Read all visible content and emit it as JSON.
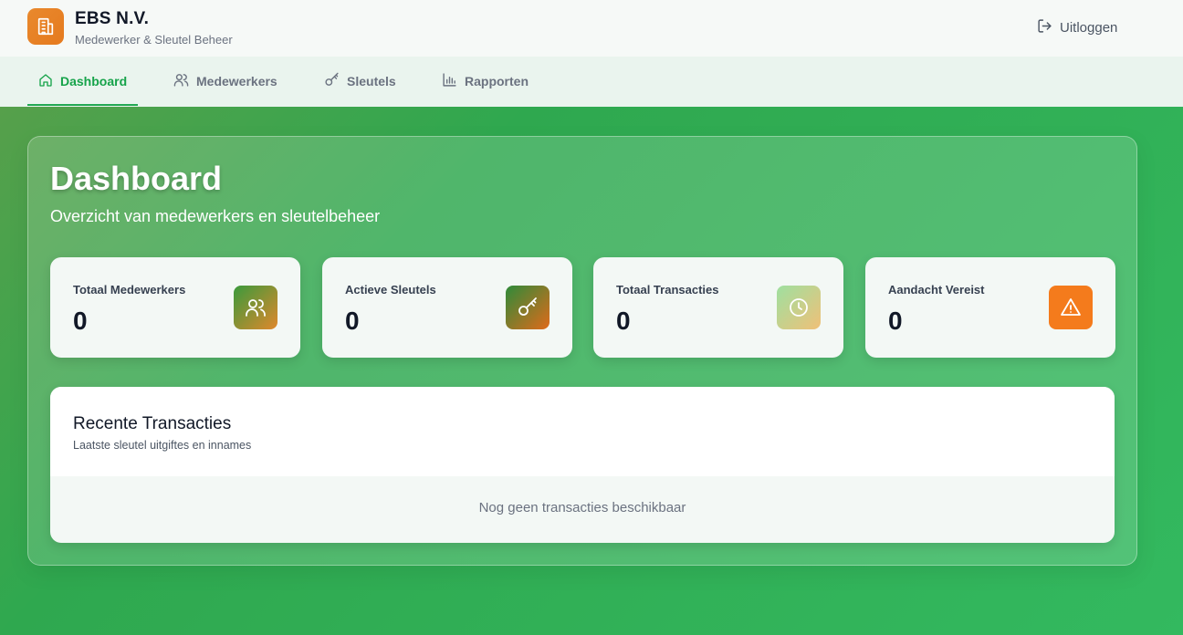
{
  "header": {
    "title": "EBS N.V.",
    "subtitle": "Medewerker & Sleutel Beheer",
    "logo_icon": "building-icon",
    "logout_label": "Uitloggen",
    "logout_icon": "logout-icon"
  },
  "nav": {
    "tabs": [
      {
        "label": "Dashboard",
        "icon": "home-icon",
        "active": true
      },
      {
        "label": "Medewerkers",
        "icon": "users-icon",
        "active": false
      },
      {
        "label": "Sleutels",
        "icon": "key-icon",
        "active": false
      },
      {
        "label": "Rapporten",
        "icon": "bar-chart-icon",
        "active": false
      }
    ]
  },
  "main": {
    "title": "Dashboard",
    "subtitle": "Overzicht van medewerkers en sleutelbeheer",
    "stats": [
      {
        "label": "Totaal Medewerkers",
        "value": "0",
        "icon": "users-icon",
        "color": "#e0882c"
      },
      {
        "label": "Actieve Sleutels",
        "value": "0",
        "icon": "key-icon",
        "color": "#2f8a3c"
      },
      {
        "label": "Totaal Transacties",
        "value": "0",
        "icon": "clock-icon",
        "color": "#a5dfa0"
      },
      {
        "label": "Aandacht Vereist",
        "value": "0",
        "icon": "warning-icon",
        "color": "#f07a1c"
      }
    ],
    "recent": {
      "title": "Recente Transacties",
      "subtitle": "Laatste sleutel uitgiftes en innames",
      "empty_text": "Nog geen transacties beschikbaar"
    }
  },
  "colors": {
    "accent": "#16a34a",
    "background": "#33b95f",
    "brand_orange": "#e57a1e"
  }
}
